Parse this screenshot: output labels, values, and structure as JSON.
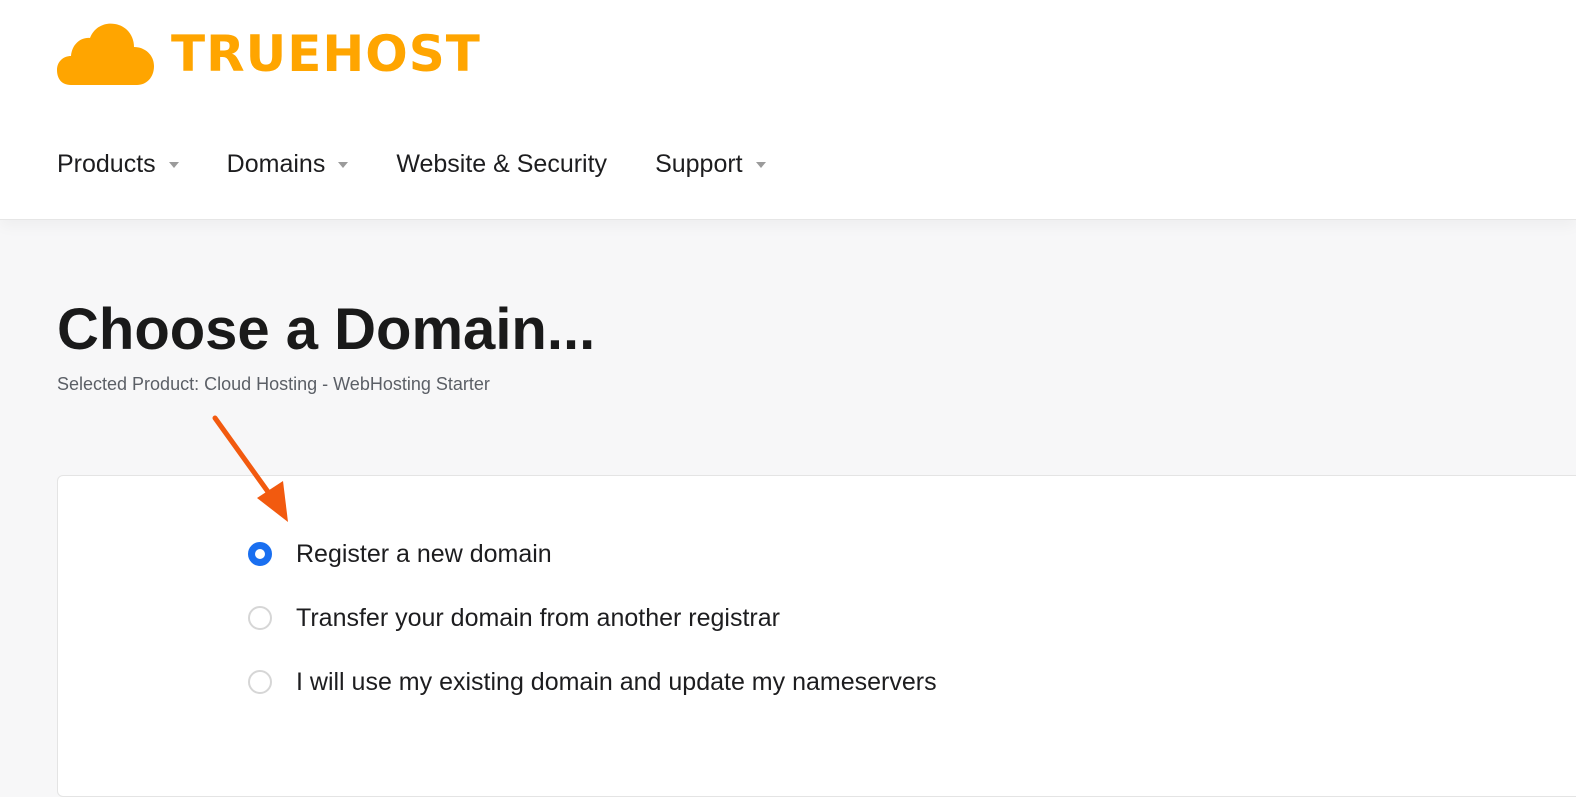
{
  "brand": {
    "name": "TRUEHOST",
    "color": "#ffa500",
    "icon": "cloud-icon"
  },
  "nav": {
    "items": [
      {
        "label": "Products",
        "has_dropdown": true
      },
      {
        "label": "Domains",
        "has_dropdown": true
      },
      {
        "label": "Website & Security",
        "has_dropdown": false
      },
      {
        "label": "Support",
        "has_dropdown": true
      }
    ]
  },
  "page": {
    "title": "Choose a Domain...",
    "subtitle": "Selected Product: Cloud Hosting - WebHosting Starter"
  },
  "domain_options": {
    "selected_index": 0,
    "items": [
      {
        "label": "Register a new domain",
        "checked": true
      },
      {
        "label": "Transfer your domain from another registrar",
        "checked": false
      },
      {
        "label": "I will use my existing domain and update my nameservers",
        "checked": false
      }
    ]
  },
  "annotation": {
    "icon": "arrow-icon",
    "color": "#f25a0f"
  },
  "colors": {
    "accent": "#1a6ff0",
    "text": "#1d1d1f",
    "muted": "#5b5f66"
  }
}
